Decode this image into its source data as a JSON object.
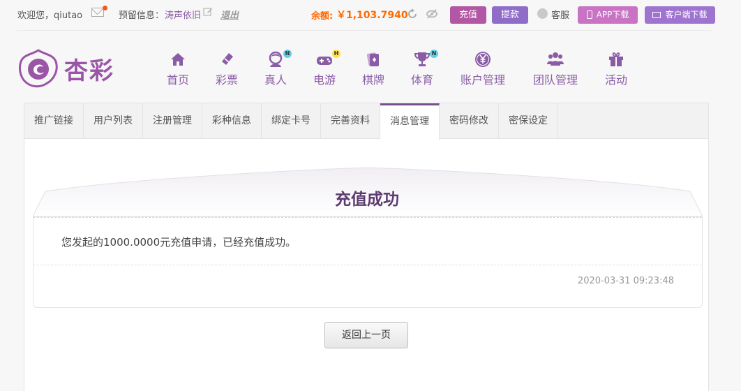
{
  "topbar": {
    "welcome": "欢迎您，qiutao",
    "reserved_label": "预留信息：",
    "reserved_value": "涛声依旧",
    "logout": "退出",
    "balance_label": "余额:",
    "balance_value": "￥1,103.7940",
    "recharge": "充值",
    "withdraw": "提款",
    "service": "客服",
    "app_download": "APP下载",
    "client_download": "客户端下载"
  },
  "logo": {
    "text": "杏彩"
  },
  "nav": [
    {
      "label": "首页",
      "icon": "home-icon"
    },
    {
      "label": "彩票",
      "icon": "ticket-icon"
    },
    {
      "label": "真人",
      "icon": "live-dealer-icon",
      "badge": "N"
    },
    {
      "label": "电游",
      "icon": "gamepad-icon",
      "badge": "H"
    },
    {
      "label": "棋牌",
      "icon": "cards-icon"
    },
    {
      "label": "体育",
      "icon": "trophy-icon",
      "badge": "N"
    },
    {
      "label": "账户管理",
      "icon": "yen-coin-icon"
    },
    {
      "label": "团队管理",
      "icon": "team-icon"
    },
    {
      "label": "活动",
      "icon": "gift-icon"
    }
  ],
  "tabs": [
    {
      "label": "推广链接"
    },
    {
      "label": "用户列表"
    },
    {
      "label": "注册管理"
    },
    {
      "label": "彩种信息"
    },
    {
      "label": "绑定卡号"
    },
    {
      "label": "完善资料"
    },
    {
      "label": "消息管理",
      "active": true
    },
    {
      "label": "密码修改"
    },
    {
      "label": "密保设定"
    }
  ],
  "message": {
    "title": "充值成功",
    "body": "您发起的1000.0000元充值申请，已经充值成功。",
    "time": "2020-03-31 09:23:48"
  },
  "back_button": "返回上一页",
  "colors": {
    "accent_purple": "#8b5ca6",
    "balance_orange": "#ff6a00",
    "recharge_btn": "#b257a4",
    "withdraw_btn": "#8f6cc7"
  }
}
